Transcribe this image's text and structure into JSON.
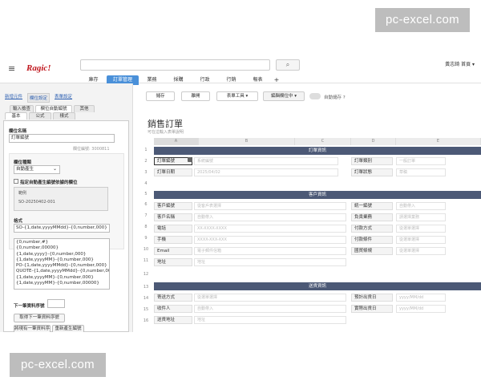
{
  "watermark": {
    "text": "pc-excel.com"
  },
  "app": {
    "logo": "Ragic!",
    "user": "黃志錡 首頁 ▾"
  },
  "search": {
    "placeholder": "",
    "button_icon": "search-icon"
  },
  "nav": {
    "tabs": [
      "庫存",
      "訂單管理",
      "業務",
      "採購",
      "行政",
      "行銷",
      "報表",
      "+"
    ],
    "active": "訂單管理"
  },
  "left": {
    "top_tabs": [
      "新增元件",
      "欄位設定",
      "表單設定"
    ],
    "active_top_tab": "欄位設定",
    "sub_tabs_row1": [
      "輸入檢查",
      "欄位自動編號",
      "其他"
    ],
    "sub_tabs_row2": [
      "基本",
      "公式",
      "樣式"
    ],
    "active_sub_tab": "欄位自動編號",
    "field_name_label": "欄位名稱",
    "field_name_value": "訂單編號",
    "field_id": "欄位編號: 3000811",
    "field_type_label": "欄位種類",
    "field_type_value": "自動產生",
    "checkbox_label": "指定自動產生編號依據的欄位",
    "example_label": "範例",
    "example_value": "SO-20250402-001",
    "format_label": "格式",
    "format_value": "SO-{1,date,yyyyMMdd}-{0,number,000}",
    "format_options": [
      "{0,number,#}",
      "{0,number,00000}",
      "{1,date,yyyy}-{0,number,000}",
      "{1,date,yyyyMM}-{0,number,000}",
      "PO-{1,date,yyyyMMdd}-{0,number,000}",
      "QUOTE-{1,date,yyyyMMdd}-{0,number,000}",
      "{1,date,yyyyMM}-{0,number,000}",
      "{1,date,yyyyMM}-{0,number,00000}"
    ],
    "next_seq_label": "下一筆資料序號",
    "next_seq_btn": "取得下一筆資料序號",
    "bottom_btn1": "將現有一筆資料序號",
    "bottom_btn2": "重新產生編號"
  },
  "toolbar": {
    "save": "儲存",
    "close": "離開",
    "tools": "表單工具 ▾",
    "editing": "編輯欄位中 ▾",
    "autosave": "自動儲存 ?"
  },
  "form": {
    "title": "銷售訂單",
    "desc": "可在這輸入表單說明",
    "cols": [
      "A",
      "B",
      "C",
      "D",
      "E"
    ],
    "rows": [
      "1",
      "2",
      "3",
      "4",
      "5",
      "6",
      "7",
      "8",
      "9",
      "10",
      "11",
      "12",
      "13",
      "14",
      "15",
      "16"
    ],
    "sections": [
      "訂單資訊",
      "客戶資訊",
      "送貨資訊"
    ],
    "fields": {
      "order_no": "訂單編號",
      "order_no_ph": "系統編號",
      "order_type": "訂單類別",
      "order_type_ph": "一般訂單",
      "order_date": "訂單日期",
      "order_date_ph": "2025/04/02",
      "order_status": "訂單狀態",
      "order_status_ph": "草稿",
      "cust_no": "客戶編號",
      "cust_no_ph": "從客戶表選擇",
      "tax_id": "統一編號",
      "tax_id_ph": "自動帶入",
      "cust_name": "客戶名稱",
      "cust_name_ph": "自動帶入",
      "sales": "負責業務",
      "sales_ph": "請選擇業務",
      "phone": "電話",
      "phone_ph": "XX-XXXX-XXXX",
      "pay_method": "付款方式",
      "pay_method_ph": "從選單選擇",
      "mobile": "手機",
      "mobile_ph": "XXXX-XXX-XXX",
      "pay_terms": "付款條件",
      "pay_terms_ph": "從選單選擇",
      "email": "Email",
      "email_ph": "電子郵件信箱",
      "trade_terms": "國貿條規",
      "trade_terms_ph": "從選單選擇",
      "address": "地址",
      "address_ph": "地址",
      "ship_method": "寄送方式",
      "ship_method_ph": "從選單選擇",
      "est_ship": "預計出貨日",
      "est_ship_ph": "yyyy/MM/dd",
      "receiver": "收件人",
      "receiver_ph": "自動帶入",
      "act_ship": "實際出貨日",
      "act_ship_ph": "yyyy/MM/dd",
      "ship_addr": "送貨地址",
      "ship_addr_ph": "地址"
    }
  }
}
